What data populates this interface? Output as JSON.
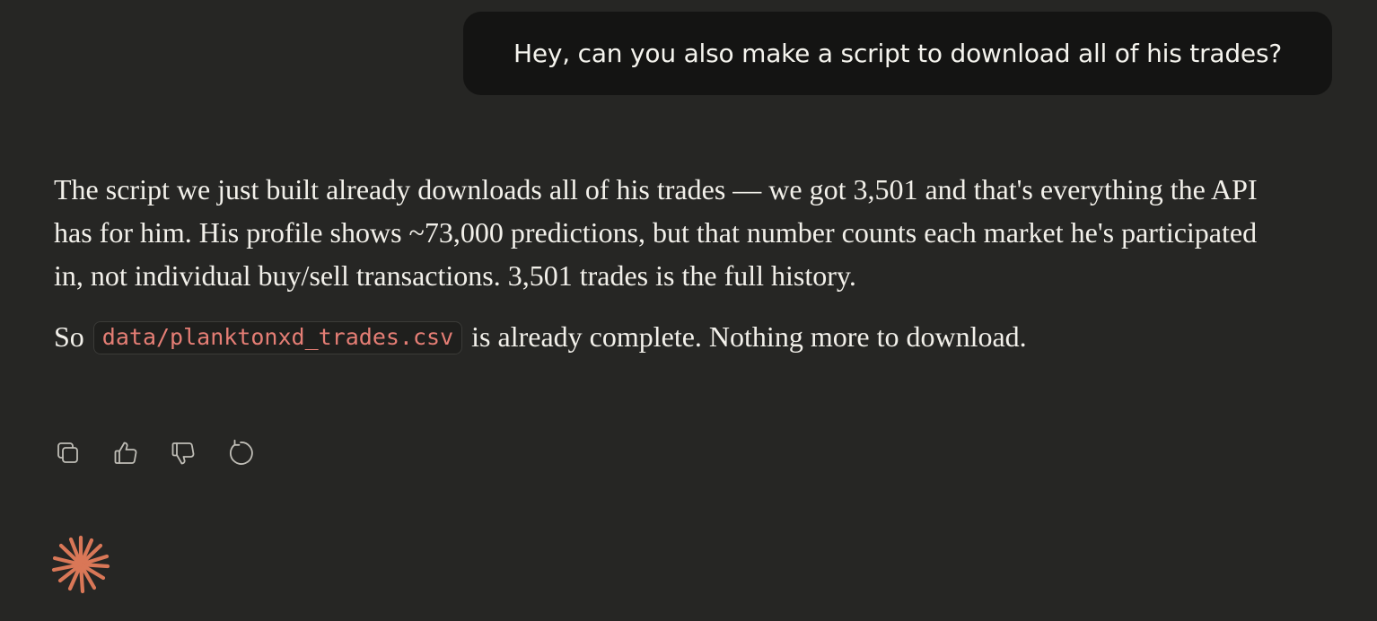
{
  "user_message": {
    "text": "Hey, can you also make a script to download all of his trades?"
  },
  "assistant_message": {
    "paragraph_1": "The script we just built already downloads all of his trades — we got 3,501 and that's everything the API has for him. His profile shows ~73,000 predictions, but that number counts each market he's participated in, not individual buy/sell transactions. 3,501 trades is the full history.",
    "paragraph_2_prefix": "So",
    "paragraph_2_code": "data/planktonxd_trades.csv",
    "paragraph_2_suffix": "is already complete. Nothing more to download."
  },
  "actions": {
    "copy_icon": "copy-icon",
    "thumbs_up_icon": "thumbs-up-icon",
    "thumbs_down_icon": "thumbs-down-icon",
    "retry_icon": "retry-icon"
  },
  "brand": {
    "logo_icon": "spark-icon",
    "accent_color": "#D97757"
  },
  "colors": {
    "background": "#262624",
    "user_bubble": "#141413",
    "code_text": "#e57e75"
  }
}
